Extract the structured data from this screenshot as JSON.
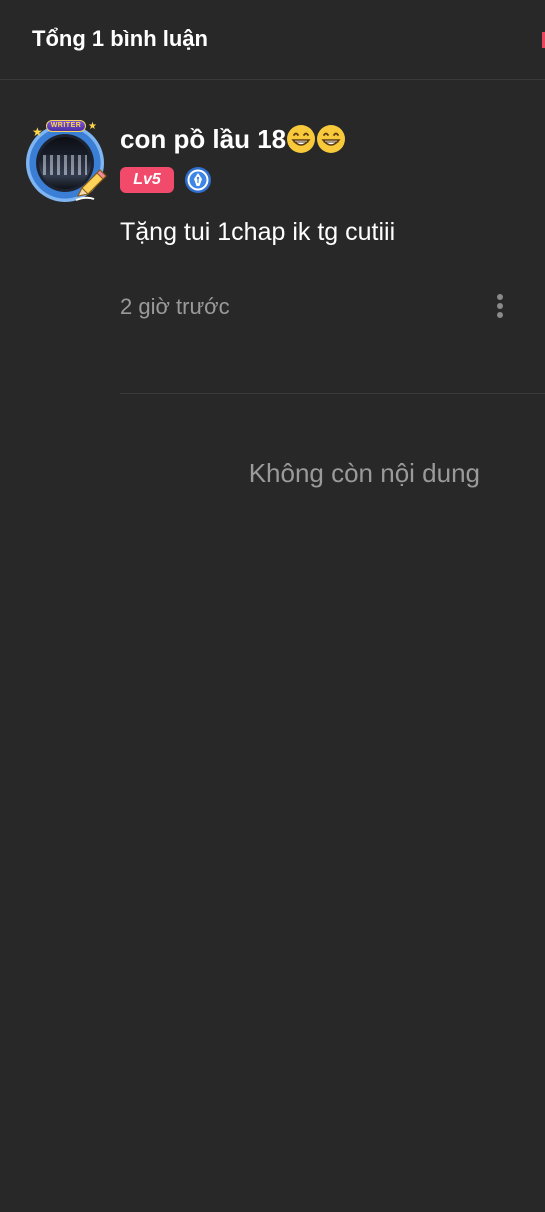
{
  "header": {
    "title": "Tổng 1 bình luận"
  },
  "comment": {
    "avatar": {
      "banner_text": "WRITER",
      "icon": "writer-avatar-frame-icon"
    },
    "username": "con pồ lầu 18",
    "username_emojis": [
      "grinning-face-icon",
      "grinning-face-icon"
    ],
    "level_badge": "Lv5",
    "author_badge_icon": "pen-nib-badge-icon",
    "text": "Tặng tui 1chap ik tg cutiii",
    "time": "2 giờ trước",
    "more_icon": "more-vertical-icon"
  },
  "footer": {
    "no_more_text": "Không còn nội dung"
  },
  "colors": {
    "background": "#282828",
    "level_badge": "#f14a6a",
    "muted_text": "#9a9a9a",
    "author_badge": "#2f6fce"
  }
}
